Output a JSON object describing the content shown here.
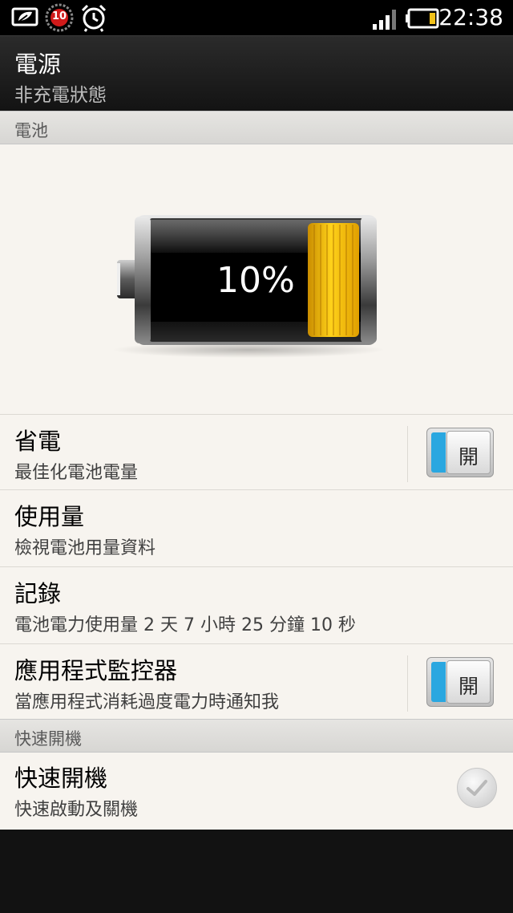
{
  "status_bar": {
    "notification_badge": "10",
    "time": "22:38",
    "icons": [
      "power-saver-icon",
      "notification-badge-icon",
      "alarm-clock-icon",
      "signal-strength-icon",
      "battery-low-icon"
    ]
  },
  "header": {
    "title": "電源",
    "subtitle": "非充電狀態"
  },
  "battery_section": {
    "label": "電池",
    "percent_text": "10%",
    "level": 0.1
  },
  "settings": [
    {
      "title": "省電",
      "subtitle": "最佳化電池電量",
      "toggle": "開"
    },
    {
      "title": "使用量",
      "subtitle": "檢視電池用量資料"
    },
    {
      "title": "記錄",
      "subtitle": "電池電力使用量 2 天 7 小時 25 分鐘 10 秒"
    },
    {
      "title": "應用程式監控器",
      "subtitle": "當應用程式消耗過度電力時通知我",
      "toggle": "開"
    }
  ],
  "fastboot_section": {
    "label": "快速開機",
    "item": {
      "title": "快速開機",
      "subtitle": "快速啟動及關機",
      "checked": false
    }
  },
  "colors": {
    "accent": "#2aa7e0",
    "battery_level": "#f2c21a",
    "background": "#f7f4ef"
  }
}
